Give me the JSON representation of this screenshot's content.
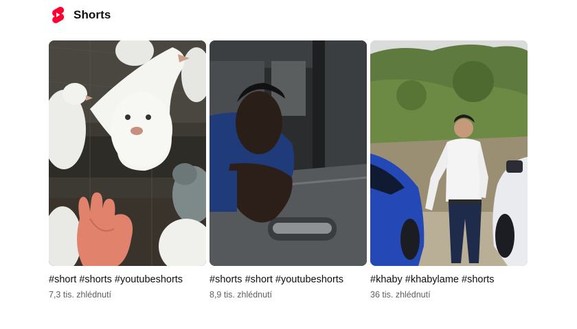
{
  "shelf": {
    "title": "Shorts",
    "logo_icon": "youtube-shorts-logo-icon",
    "accent": "#ff0033"
  },
  "shorts": [
    {
      "title": "#short #shorts #youtubeshorts",
      "views": "7,3 tis. zhlédnutí",
      "thumbnail": "white-doves-and-open-hand"
    },
    {
      "title": "#shorts #short #youtubeshorts",
      "views": "8,9 tis. zhlédnutí",
      "thumbnail": "man-leaning-out-of-car-window"
    },
    {
      "title": "#khaby #khabylame #shorts",
      "views": "36 tis. zhlédnutí",
      "thumbnail": "man-between-blue-and-white-cars"
    }
  ]
}
